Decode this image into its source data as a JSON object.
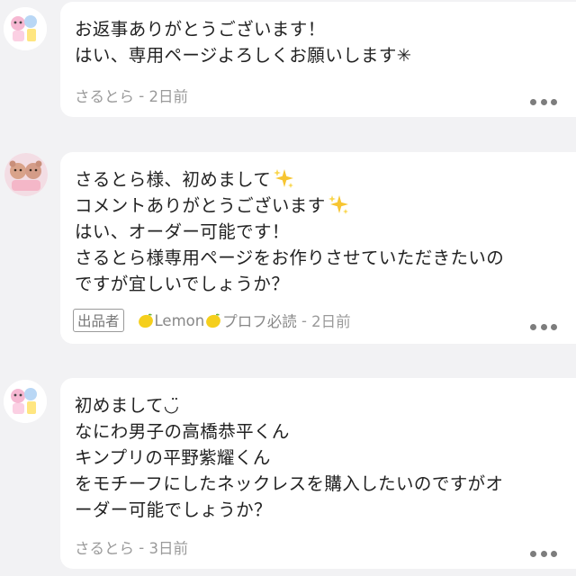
{
  "comments": [
    {
      "lines": [
        "お返事ありがとうございます！",
        "はい、専用ページよろしくお願いします✳︎"
      ],
      "author": "さるとら",
      "separator": " - ",
      "time": "2日前"
    },
    {
      "lines": [
        "さるとら様、初めまして",
        "コメントありがとうございます",
        "はい、オーダー可能です！",
        "さるとら様専用ページをお作りさせていただきたいの",
        "ですが宜しいでしょうか？"
      ],
      "badge": "出品者",
      "author": "Lemon",
      "author_suffix": "プロフ必読",
      "separator": " - ",
      "time": "2日前"
    },
    {
      "lines": [
        "初めまして◡̈",
        "なにわ男子の高橋恭平くん",
        "キンプリの平野紫耀くん",
        "をモチーフにしたネックレスを購入したいのですがオ",
        "ーダー可能でしょうか？"
      ],
      "author": "さるとら",
      "separator": " - ",
      "time": "3日前"
    }
  ],
  "icons": {
    "sparkle": "sparkles-icon",
    "lemon": "lemon-icon",
    "more": "more-options-icon"
  },
  "colors": {
    "background": "#f2f2f4",
    "bubble": "#ffffff",
    "meta_text": "#9a9a9a"
  }
}
